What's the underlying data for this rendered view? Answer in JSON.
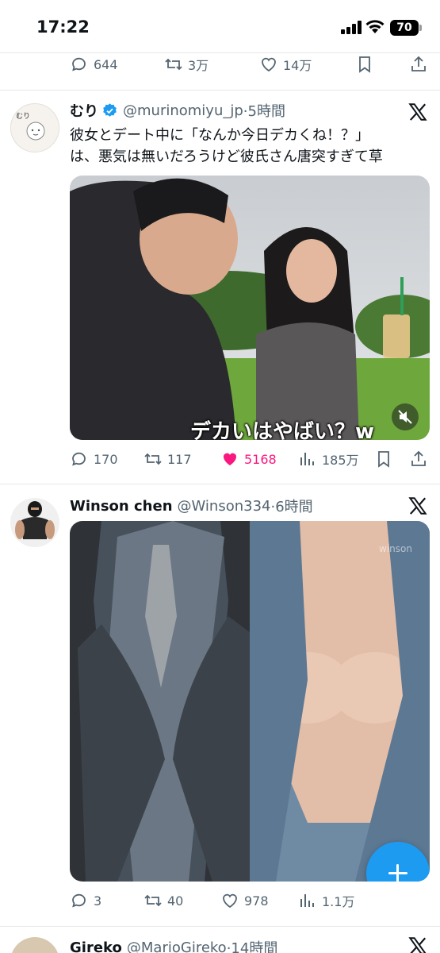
{
  "status_bar": {
    "time": "17:22",
    "battery": "70"
  },
  "prev_tweet": {
    "actions": {
      "replies": "644",
      "retweets": "3万",
      "likes": "14万"
    }
  },
  "tweet1": {
    "name": "むり",
    "handle": "@murinomiyu_jp",
    "time": "·5時間",
    "text_line1": "彼女とデート中に「なんか今日デカくね！？」",
    "text_line2": "は、悪気は無いだろうけど彼氏さん唐突すぎて草",
    "video_caption": "デカいはやばい？w",
    "avatar_text": "むり",
    "actions": {
      "replies": "170",
      "retweets": "117",
      "likes": "5168",
      "views": "185万"
    },
    "like_color": "#f91880"
  },
  "tweet2": {
    "name": "Winson chen",
    "handle": "@Winson334",
    "time": "·6時間",
    "watermark": "winson",
    "actions": {
      "replies": "3",
      "retweets": "40",
      "likes": "978",
      "views": "1.1万"
    }
  },
  "tweet3": {
    "name": "Gireko",
    "handle": "@MarioGireko",
    "time": "·14時間"
  },
  "colors": {
    "accent": "#1d9bf0",
    "verified": "#1d9bf0",
    "muted": "#536471"
  },
  "icons": [
    "reply-icon",
    "retweet-icon",
    "like-icon",
    "views-icon",
    "bookmark-icon",
    "share-icon",
    "x-logo-icon",
    "compose-icon"
  ]
}
